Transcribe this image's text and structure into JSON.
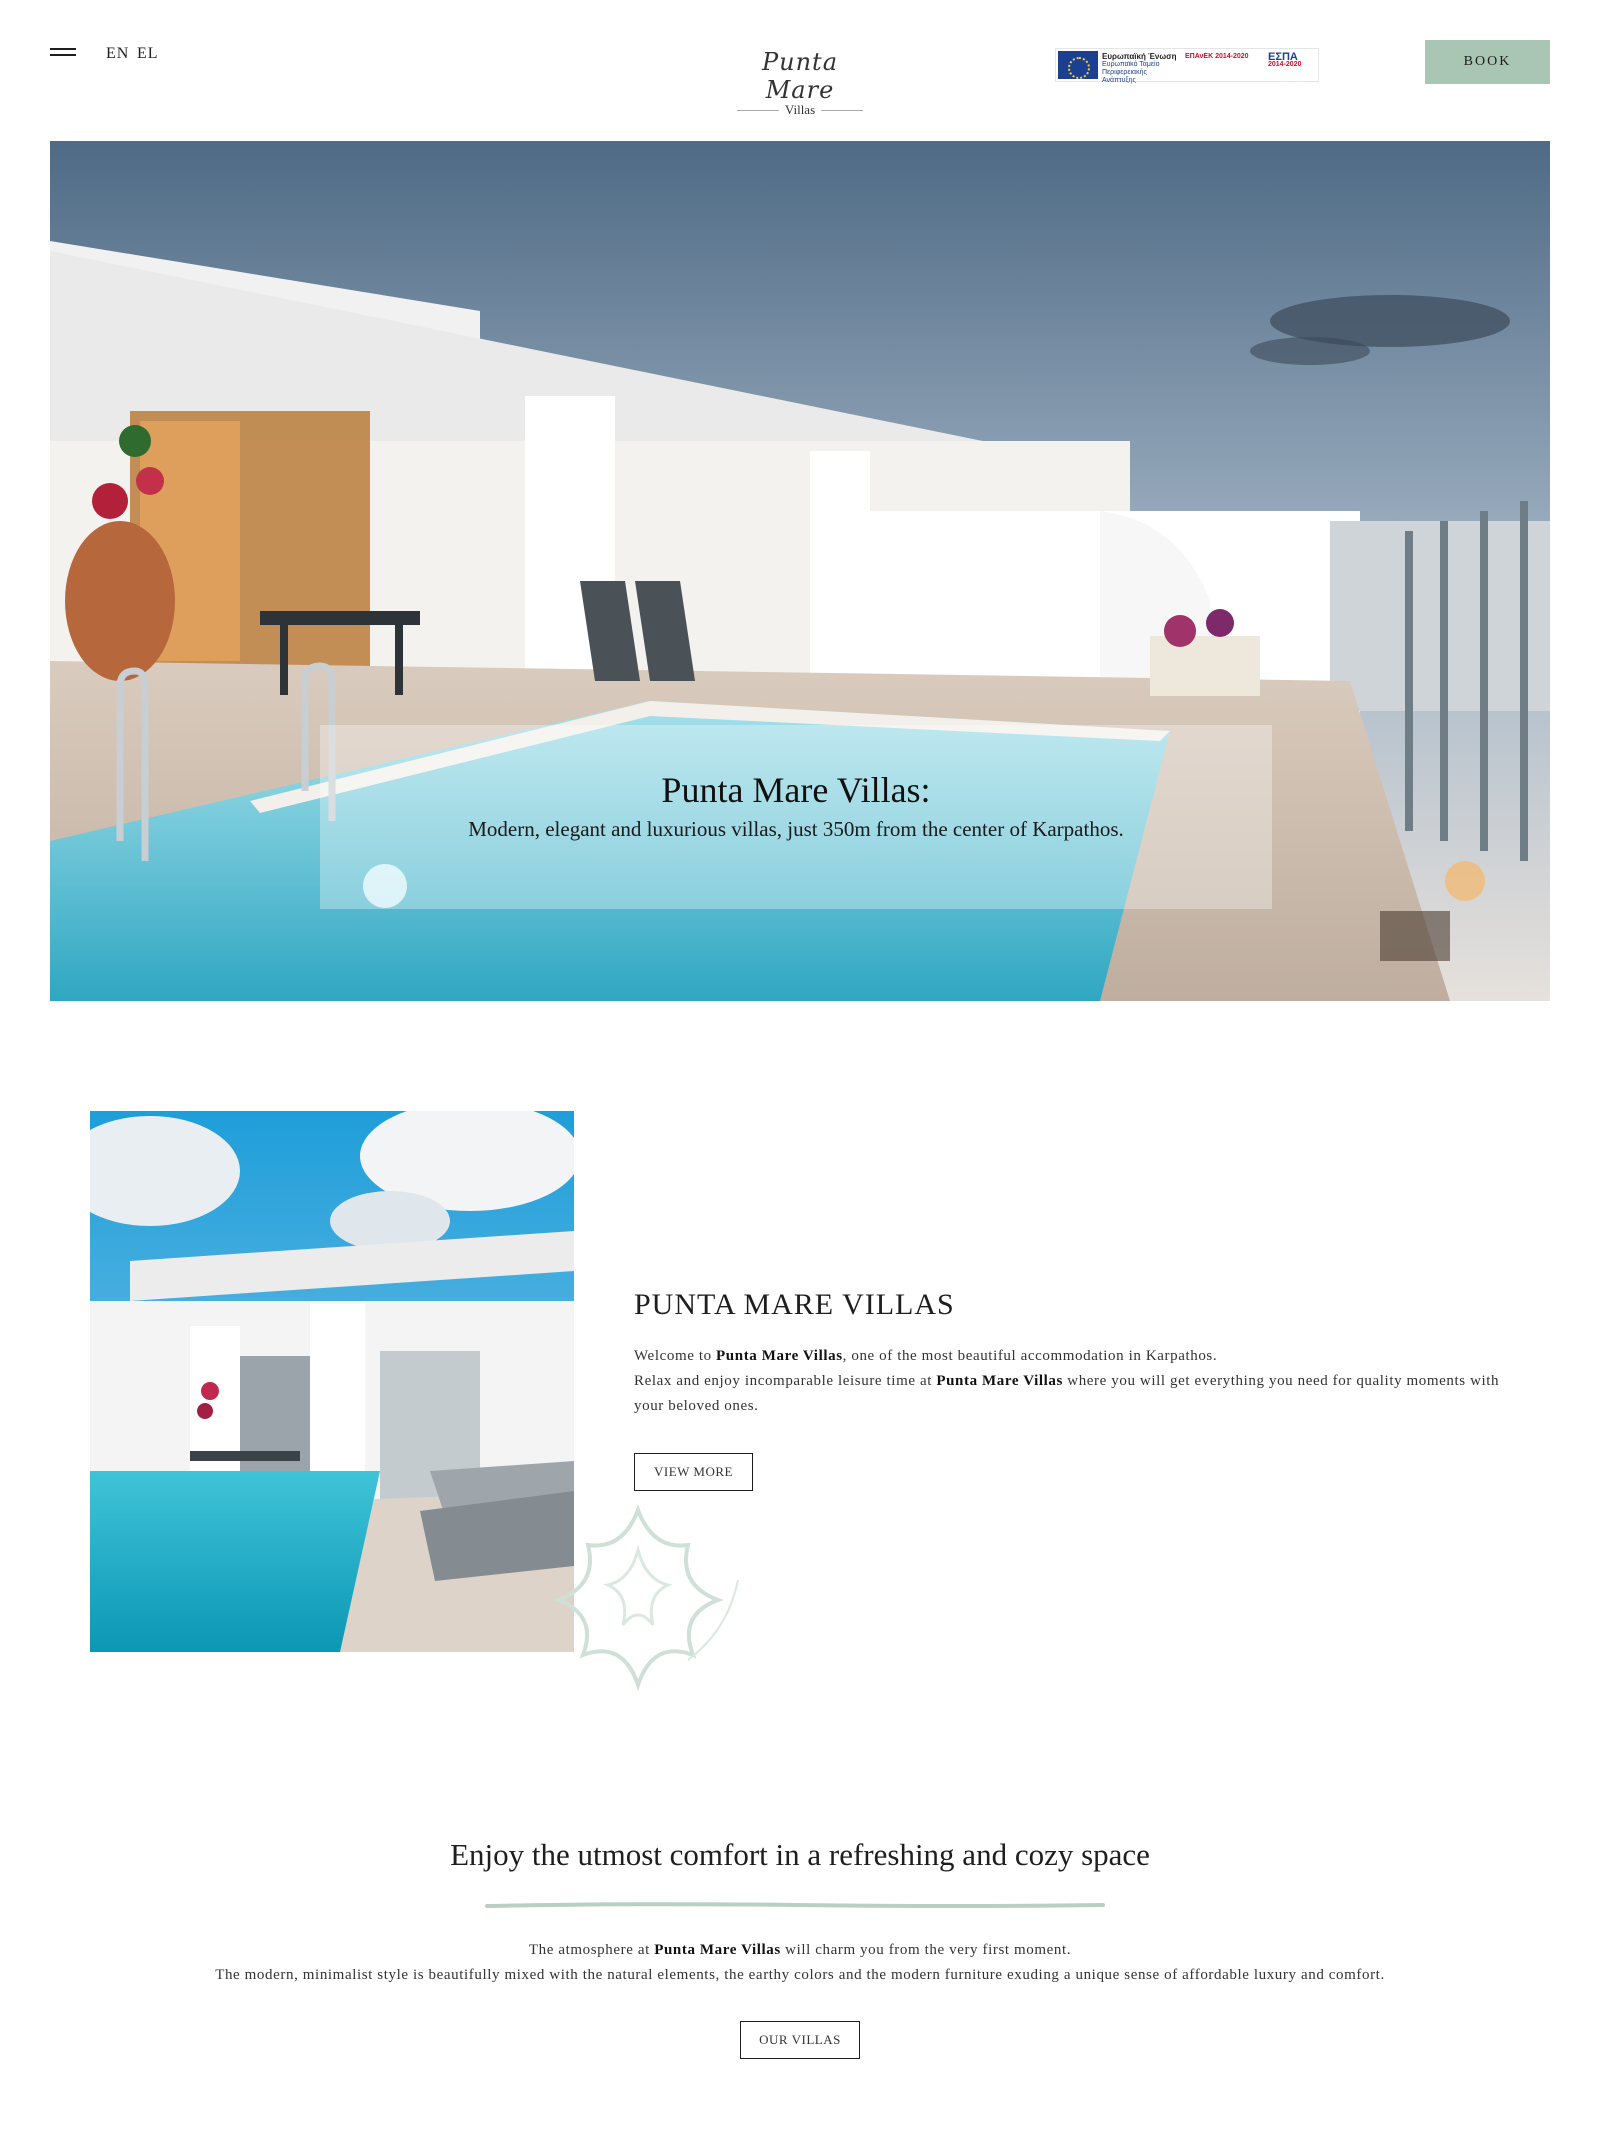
{
  "header": {
    "lang_en": "EN",
    "lang_el": "EL",
    "logo_script": "Punta Mare",
    "logo_sub": "Villas",
    "espa": {
      "eu_title": "Ευρωπαϊκή Ένωση",
      "eu_line1": "Ευρωπαϊκό Ταμείο",
      "eu_line2": "Περιφερειακής Ανάπτυξης",
      "epanek": "ΕΠΑνΕΚ 2014-2020",
      "espa": "ΕΣΠΑ",
      "espa_years": "2014-2020"
    },
    "book_label": "BOOK"
  },
  "hero": {
    "title": "Punta Mare Villas:",
    "subtitle": "Modern, elegant and luxurious villas, just 350m from the center of Karpathos."
  },
  "about": {
    "title": "PUNTA MARE VILLAS",
    "line1_pre": "Welcome to ",
    "line1_bold": "Punta Mare Villas",
    "line1_post": ", one of the most beautiful accommodation in Karpathos.",
    "line2_pre": "Relax and enjoy incomparable leisure time at ",
    "line2_bold": "Punta Mare Villas",
    "line2_post": " where you will get everything you need for quality moments with your beloved ones.",
    "button_label": "VIEW MORE"
  },
  "comfort": {
    "title": "Enjoy the utmost comfort in a refreshing and cozy space",
    "line1_pre": "The atmosphere at ",
    "line1_bold": "Punta Mare Villas",
    "line1_post": " will charm you from the very first moment.",
    "line2": "The modern, minimalist style is beautifully mixed with the natural elements, the earthy colors and the modern furniture exuding a unique sense of affordable luxury and comfort.",
    "button_label": "OUR VILLAS"
  },
  "colors": {
    "accent": "#a9c6b5",
    "pool": "#4fc3d9",
    "text": "#1e1e1e"
  },
  "icons": {
    "menu": "hamburger-icon",
    "flower": "flower-decoration-icon"
  }
}
